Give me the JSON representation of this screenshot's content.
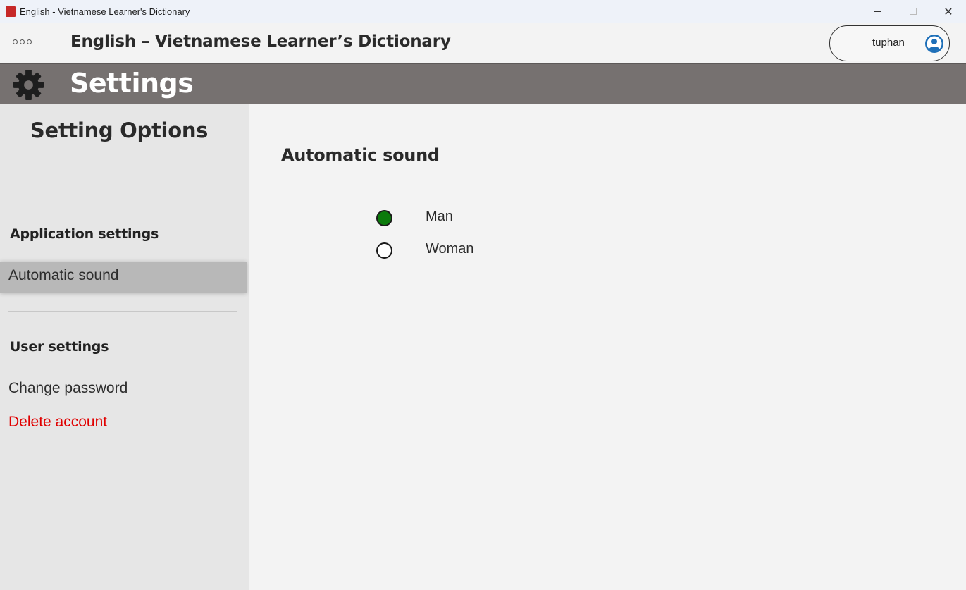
{
  "window": {
    "title": "English - Vietnamese Learner's Dictionary",
    "controls": {
      "minimize": "minimize",
      "maximize": "maximize",
      "close": "✕"
    }
  },
  "header": {
    "app_title": "English – Vietnamese Learner’s Dictionary",
    "more_icon": "more-horizontal-icon",
    "user": {
      "name": "tuphan",
      "avatar_icon": "user-circle-icon"
    }
  },
  "banner": {
    "icon": "gear-icon",
    "title": "Settings"
  },
  "sidebar": {
    "title": "Setting Options",
    "sections": [
      {
        "heading": "Application settings",
        "items": [
          {
            "label": "Automatic sound",
            "active": true
          }
        ]
      },
      {
        "heading": "User settings",
        "items": [
          {
            "label": "Change password"
          },
          {
            "label": "Delete account",
            "danger": true
          }
        ]
      }
    ]
  },
  "main": {
    "title": "Automatic sound",
    "options": [
      {
        "label": "Man",
        "checked": true
      },
      {
        "label": "Woman",
        "checked": false
      }
    ]
  },
  "colors": {
    "banner": "#767170",
    "radio_selected": "#0b7a0b",
    "danger": "#e00000",
    "avatar": "#1e6fb8"
  }
}
